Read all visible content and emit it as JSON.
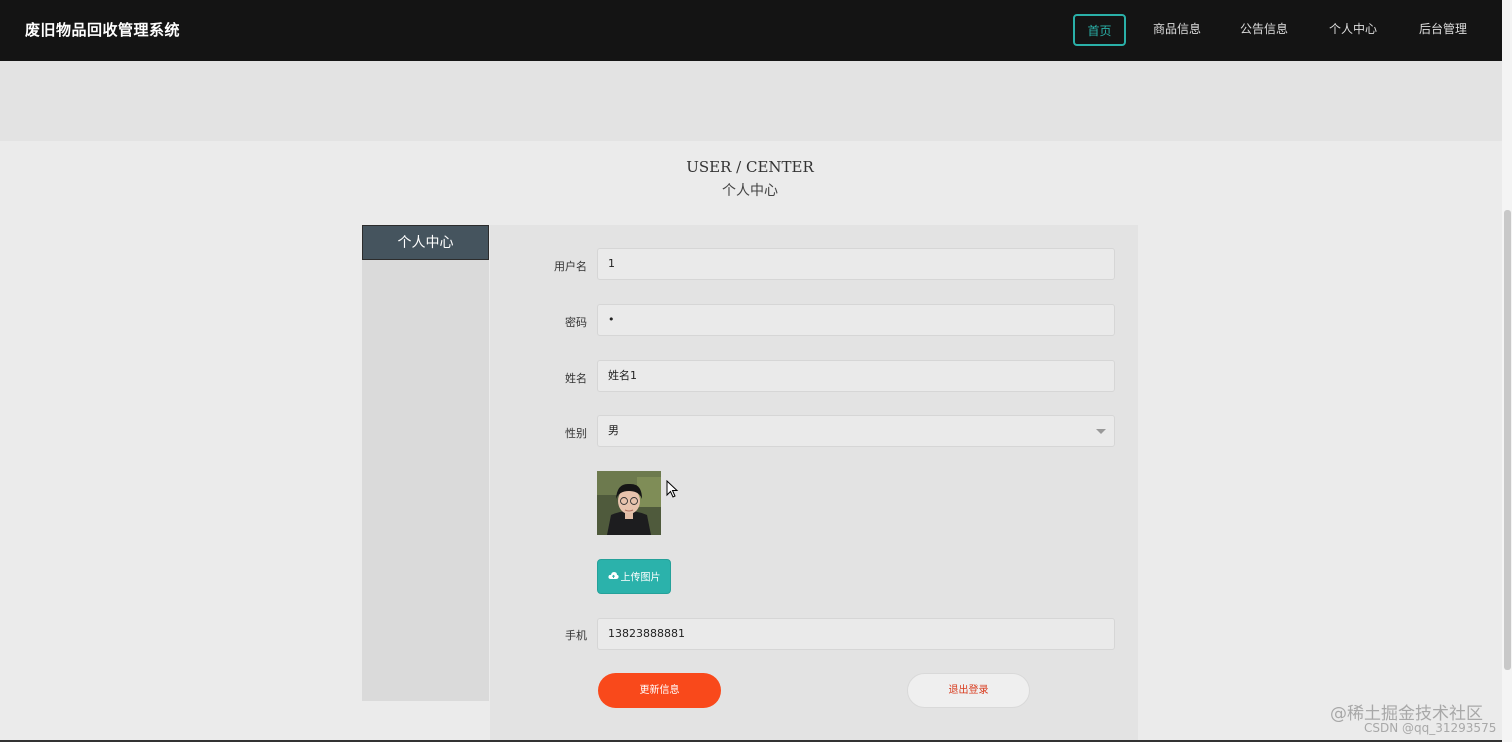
{
  "navbar": {
    "brand": "废旧物品回收管理系统",
    "items": [
      {
        "label": "首页",
        "active": true
      },
      {
        "label": "商品信息",
        "active": false
      },
      {
        "label": "公告信息",
        "active": false
      },
      {
        "label": "个人中心",
        "active": false
      },
      {
        "label": "后台管理",
        "active": false
      }
    ]
  },
  "section": {
    "title_en": "USER / CENTER",
    "title_cn": "个人中心"
  },
  "sidebar": {
    "header": "个人中心"
  },
  "form": {
    "username": {
      "label": "用户名",
      "value": "1"
    },
    "password": {
      "label": "密码",
      "value": "•"
    },
    "name": {
      "label": "姓名",
      "value": "姓名1"
    },
    "gender": {
      "label": "性别",
      "value": "男"
    },
    "upload_label": "上传图片",
    "phone": {
      "label": "手机",
      "value": "13823888881"
    }
  },
  "actions": {
    "update": "更新信息",
    "logout": "退出登录"
  },
  "watermark": {
    "line1": "@稀土掘金技术社区",
    "line2": "CSDN @qq_31293575"
  },
  "colors": {
    "navbar_bg": "#141414",
    "accent_teal": "#2ab0a8",
    "update_button": "#f9491b",
    "sidebar_header": "#45545e"
  }
}
